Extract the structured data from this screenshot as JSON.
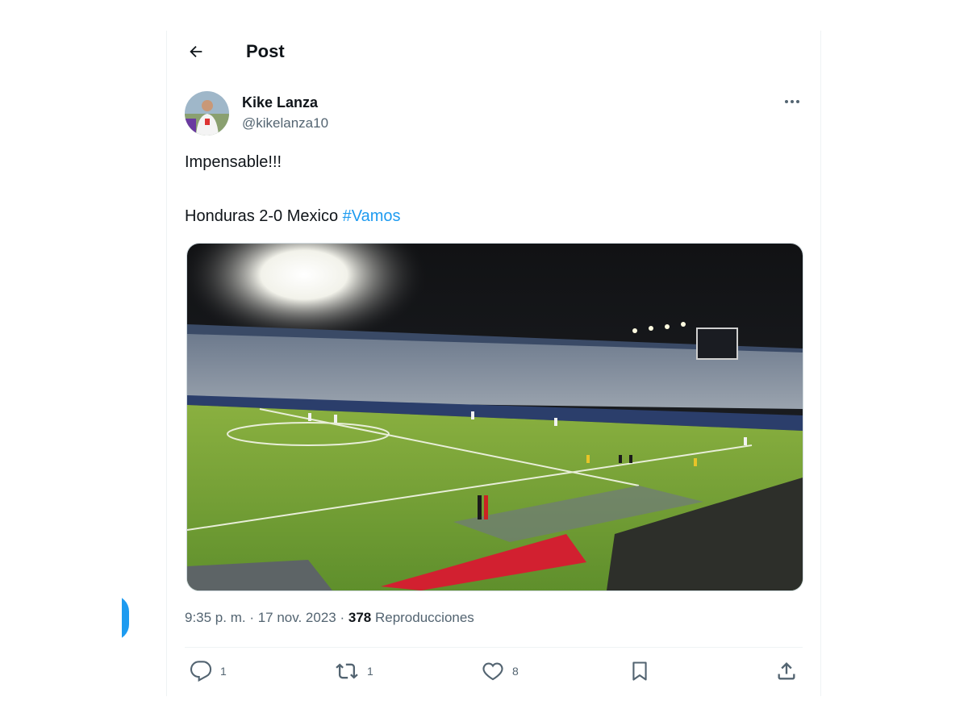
{
  "header": {
    "title": "Post"
  },
  "tweet": {
    "author_name": "Kike Lanza",
    "author_handle": "@kikelanza10",
    "line1": "Impensable!!!",
    "line2_text": "Honduras 2-0 Mexico ",
    "hashtag": "#Vamos",
    "time": "9:35 p. m. · 17 nov. 2023 · ",
    "views_count": "378",
    "views_label": " Reproducciones"
  },
  "actions": {
    "replies": "1",
    "reposts": "1",
    "likes": "8"
  },
  "icons": {
    "back": "arrow-left-icon",
    "more": "more-horizontal-icon",
    "reply": "reply-icon",
    "repost": "repost-icon",
    "like": "heart-icon",
    "bookmark": "bookmark-icon",
    "share": "share-icon"
  },
  "colors": {
    "accent": "#1d9bf0",
    "muted": "#536471",
    "text": "#0f1419",
    "divider": "#eff3f4"
  }
}
